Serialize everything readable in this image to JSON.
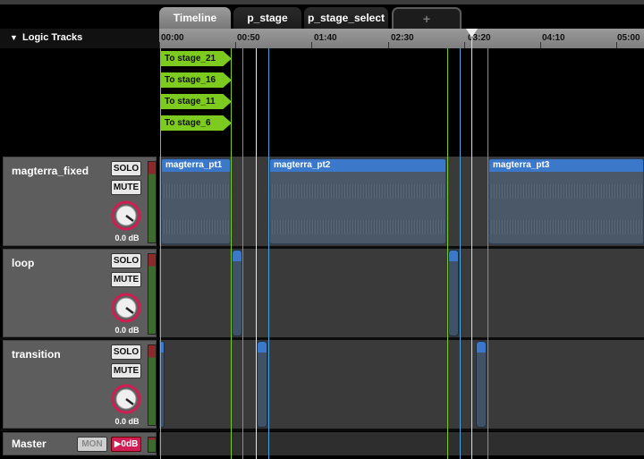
{
  "tabs": {
    "items": [
      {
        "label": "Timeline",
        "active": true
      },
      {
        "label": "p_stage",
        "active": false
      },
      {
        "label": "p_stage_select",
        "active": false
      }
    ],
    "add_label": "+"
  },
  "logic": {
    "header_label": "Logic Tracks",
    "collapse_glyph": "▼",
    "markers": [
      "To stage_21",
      "To stage_16",
      "To stage_11",
      "To stage_6"
    ]
  },
  "ruler": {
    "ticks": [
      "00:00",
      "00:50",
      "01:40",
      "02:30",
      "03:20",
      "04:10",
      "05:00"
    ]
  },
  "tracks": [
    {
      "name": "magterra_fixed",
      "solo": "SOLO",
      "mute": "MUTE",
      "gain": "0.0 dB",
      "clips": [
        "magterra_pt1",
        "magterra_pt2",
        "magterra_pt3"
      ]
    },
    {
      "name": "loop",
      "solo": "SOLO",
      "mute": "MUTE",
      "gain": "0.0 dB",
      "clips": []
    },
    {
      "name": "transition",
      "solo": "SOLO",
      "mute": "MUTE",
      "gain": "0.0 dB",
      "clips": []
    }
  ],
  "master": {
    "name": "Master",
    "mon_label": "MON",
    "level_label": "▶0dB"
  },
  "colors": {
    "accent_green": "#7ecb1f",
    "clip_blue": "#3b78c9",
    "knob_ring": "#d01e54",
    "tab_active": "#8a8a8a"
  }
}
